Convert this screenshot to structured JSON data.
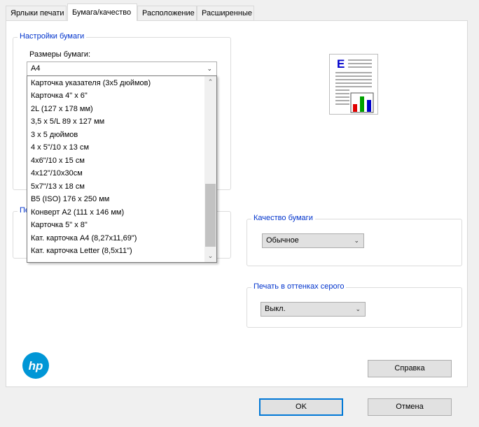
{
  "tabs": [
    {
      "label": "Ярлыки печати"
    },
    {
      "label": "Бумага/качество"
    },
    {
      "label": "Расположение"
    },
    {
      "label": "Расширенные"
    }
  ],
  "paper_settings": {
    "group_label": "Настройки бумаги",
    "size_label": "Размеры бумаги:",
    "size_value": "A4",
    "size_options": [
      "Карточка указателя (3x5 дюймов)",
      "Карточка 4\" x 6\"",
      "2L (127 x 178 мм)",
      "3,5 x 5/L 89 x 127 мм",
      "3 x 5 дюймов",
      "4 x 5\"/10 x 13 см",
      "4x6\"/10 x 15 см",
      "4x12\"/10x30см",
      "5x7\"/13 x 18 см",
      "B5 (ISO) 176 x 250 мм",
      "Конверт A2 (111 x 146 мм)",
      "Карточка 5\" x 8\"",
      "Кат. карточка A4 (8,27x11,69\")",
      "Кат. карточка Letter (8,5x11\")"
    ]
  },
  "hidden_group": {
    "label_fragment": "Пе"
  },
  "print_quality": {
    "group_label": "Качество бумаги",
    "value": "Обычное"
  },
  "grayscale": {
    "group_label": "Печать в оттенках серого",
    "value": "Выкл."
  },
  "buttons": {
    "help": "Справка",
    "ok": "OK",
    "cancel": "Отмена"
  },
  "preview": {
    "letter": "E",
    "bar_colors": [
      "#e00000",
      "#00a000",
      "#0000cc"
    ]
  },
  "colors": {
    "group_label": "#0033cc",
    "hp_blue": "#0096d6",
    "default_button_border": "#0078d7"
  }
}
